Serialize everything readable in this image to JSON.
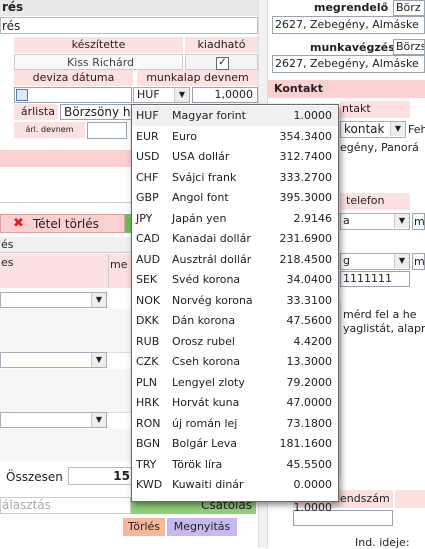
{
  "left": {
    "top_fragment": "rés",
    "top_fragment2": "rés",
    "hdr_keszitette": "készítette",
    "hdr_kiadhato": "kiadható",
    "keszitette_value": "Kiss Richárd",
    "hdr_deviza_datuma": "deviza dátuma",
    "hdr_munkalap_devnem": "munkalap devnem",
    "currency_value": "HUF",
    "rate_value": "1,0000",
    "arlista_label": "árlista",
    "arlista_value": "Börzsöny h",
    "arl_devnem_label": "árl. devnem",
    "tetel_torles": "Tétel törlés",
    "es_fragment": "és",
    "es_fragment2": "es",
    "me_fragment": "me",
    "osszesen_label": "Összesen",
    "osszesen_value": "15",
    "valasztas_placeholder": "álasztás",
    "csatolas_label": "Csatolás",
    "torles_label": "Törlés",
    "megnyitas_label": "Megnyitás"
  },
  "right": {
    "megrendelo_label": "megrendelő",
    "megrendelo_value": "Börz",
    "address1": "2627, Zebegény, Almáske",
    "munkavegzes_label": "munkavégzés",
    "munkavegzes_value": "Börzs",
    "address2": "2627, Zebegény, Almáske",
    "kontakt_header": "Kontakt",
    "ntakt_fragment": "ntakt",
    "kontakt_select": "kontak",
    "feh_fragment": "Feh",
    "egeny_fragment": "egény, Panorá",
    "telefon_label": "telefon",
    "a_fragment": "a",
    "m_fragment": "m",
    "g_fragment": "g",
    "m_fragment2": "m",
    "phone_fragment": "1111111",
    "note_line1": "mérd fel a he",
    "note_line2": "yaglistát, alapr",
    "fendszam_label": "endszám",
    "ind_ideje_label": "Ind. ideje:"
  },
  "dropdown": {
    "items": [
      {
        "code": "HUF",
        "name": "Magyar forint",
        "rate": "1.0000"
      },
      {
        "code": "EUR",
        "name": "Euro",
        "rate": "354.3400"
      },
      {
        "code": "USD",
        "name": "USA dollár",
        "rate": "312.7400"
      },
      {
        "code": "CHF",
        "name": "Svájci frank",
        "rate": "333.2700"
      },
      {
        "code": "GBP",
        "name": "Angol font",
        "rate": "395.3000"
      },
      {
        "code": "JPY",
        "name": "Japán yen",
        "rate": "2.9146"
      },
      {
        "code": "CAD",
        "name": "Kanadai dollár",
        "rate": "231.6900"
      },
      {
        "code": "AUD",
        "name": "Ausztrál dollár",
        "rate": "218.4500"
      },
      {
        "code": "SEK",
        "name": "Svéd korona",
        "rate": "34.0400"
      },
      {
        "code": "NOK",
        "name": "Norvég korona",
        "rate": "33.3100"
      },
      {
        "code": "DKK",
        "name": "Dán korona",
        "rate": "47.5600"
      },
      {
        "code": "RUB",
        "name": "Orosz rubel",
        "rate": "4.4200"
      },
      {
        "code": "CZK",
        "name": "Cseh korona",
        "rate": "13.3000"
      },
      {
        "code": "PLN",
        "name": "Lengyel zloty",
        "rate": "79.2000"
      },
      {
        "code": "HRK",
        "name": "Horvát kuna",
        "rate": "47.0000"
      },
      {
        "code": "RON",
        "name": "új román lej",
        "rate": "73.1800"
      },
      {
        "code": "BGN",
        "name": "Bolgár Leva",
        "rate": "181.1600"
      },
      {
        "code": "TRY",
        "name": "Török líra",
        "rate": "45.5500"
      },
      {
        "code": "KWD",
        "name": "Kuwaiti dinár",
        "rate": "0.0000"
      }
    ],
    "footer_value": "1.0000"
  },
  "colors": {
    "header_pink": "#fde0e0",
    "salmon_bar": "#fbd0d0",
    "green_button": "#8fd07a",
    "torles_bg": "#f7b89a",
    "megnyitas_bg": "#c8b8f0"
  }
}
